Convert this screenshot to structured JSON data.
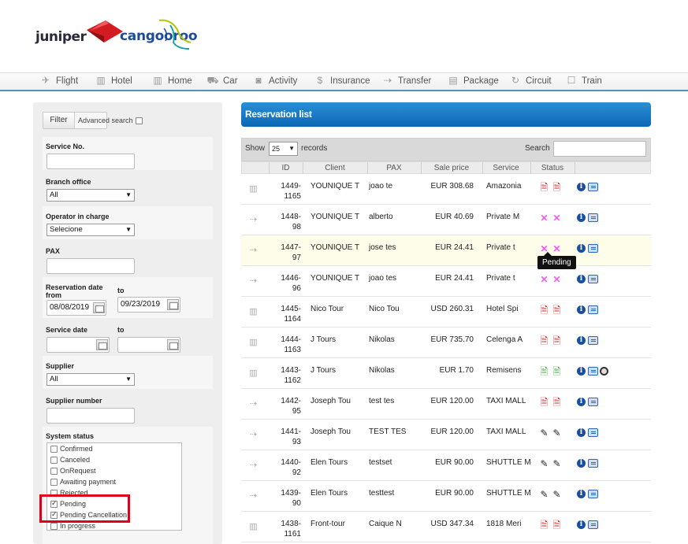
{
  "brand": {
    "left_logo": "juniper",
    "right_logo": "cangooroo",
    "accent": "#0b67b5",
    "highlight_red": "#e0001b"
  },
  "nav": [
    {
      "label": "Flight",
      "icon": "airplane-icon"
    },
    {
      "label": "Hotel",
      "icon": "building-icon"
    },
    {
      "label": "Home",
      "icon": "building-icon"
    },
    {
      "label": "Car",
      "icon": "car-icon"
    },
    {
      "label": "Activity",
      "icon": "camera-icon"
    },
    {
      "label": "Insurance",
      "icon": "dollar-icon"
    },
    {
      "label": "Transfer",
      "icon": "van-icon"
    },
    {
      "label": "Package",
      "icon": "briefcase-icon"
    },
    {
      "label": "Circuit",
      "icon": "cycle-icon"
    },
    {
      "label": "Train",
      "icon": "train-icon"
    }
  ],
  "filter": {
    "button_label": "Filter",
    "advanced_search_label": "Advanced search",
    "advanced_search_checked": false,
    "service_no_label": "Service No.",
    "service_no_value": "",
    "branch_office_label": "Branch office",
    "branch_office_value": "All",
    "operator_label": "Operator in charge",
    "operator_value": "Selecione",
    "pax_label": "PAX",
    "pax_value": "",
    "res_date_label": "Reservation date from",
    "res_date_to_label": "to",
    "res_date_from": "08/08/2019",
    "res_date_to": "09/23/2019",
    "service_date_label": "Service date",
    "service_date_to_label": "to",
    "service_date_from": "",
    "service_date_to": "",
    "supplier_label": "Supplier",
    "supplier_value": "All",
    "supplier_number_label": "Supplier number",
    "supplier_number_value": "",
    "system_status_label": "System status",
    "statuses": [
      {
        "label": "Confirmed",
        "checked": false
      },
      {
        "label": "Canceled",
        "checked": false
      },
      {
        "label": "OnRequest",
        "checked": false
      },
      {
        "label": "Awaiting payment",
        "checked": false
      },
      {
        "label": "Rejected",
        "checked": false
      },
      {
        "label": "Pending",
        "checked": true
      },
      {
        "label": "Pending Cancellation",
        "checked": true
      },
      {
        "label": "In progress",
        "checked": false
      }
    ]
  },
  "list": {
    "title": "Reservation list",
    "show_label": "Show",
    "page_size": "25",
    "records_label": "records",
    "search_label": "Search",
    "search_value": "",
    "columns": [
      "ID",
      "Client",
      "PAX",
      "Sale price",
      "Service",
      "Status"
    ],
    "tooltip": "Pending",
    "rows": [
      {
        "service_icon": "building-icon",
        "id_line1": "1449-",
        "id_line2": "1165",
        "client": "YOUNIQUE T",
        "pax": "joao te",
        "price": "EUR 308.68",
        "service": "Amazonia",
        "status_icon": "pdf-red-icon",
        "status_color": "red",
        "highlight": false,
        "extra_icon": false
      },
      {
        "service_icon": "van-icon",
        "id_line1": "1448-",
        "id_line2": "98",
        "client": "YOUNIQUE T",
        "pax": "alberto",
        "price": "EUR 40.69",
        "service": "Private M",
        "status_icon": "pending-x-icon",
        "status_color": "pink",
        "highlight": false,
        "extra_icon": false
      },
      {
        "service_icon": "van-icon",
        "id_line1": "1447-",
        "id_line2": "97",
        "client": "YOUNIQUE T",
        "pax": "jose tes",
        "price": "EUR 24.41",
        "service": "Private t",
        "status_icon": "pending-x-icon",
        "status_color": "pink",
        "highlight": true,
        "extra_icon": false
      },
      {
        "service_icon": "van-icon",
        "id_line1": "1446-",
        "id_line2": "96",
        "client": "YOUNIQUE T",
        "pax": "joao tes",
        "price": "EUR 24.41",
        "service": "Private t",
        "status_icon": "pending-x-icon",
        "status_color": "pink",
        "highlight": false,
        "extra_icon": false
      },
      {
        "service_icon": "building-icon",
        "id_line1": "1445-",
        "id_line2": "1164",
        "client": "Nico Tour",
        "pax": "Nico Tou",
        "price": "USD 260.31",
        "service": "Hotel Spi",
        "status_icon": "pdf-red-icon",
        "status_color": "red",
        "highlight": false,
        "extra_icon": false
      },
      {
        "service_icon": "building-icon",
        "id_line1": "1444-",
        "id_line2": "1163",
        "client": "J Tours",
        "pax": "Nikolas",
        "price": "EUR 735.70",
        "service": "Celenga A",
        "status_icon": "pdf-red-icon",
        "status_color": "red",
        "highlight": false,
        "extra_icon": false
      },
      {
        "service_icon": "building-icon",
        "id_line1": "1443-",
        "id_line2": "1162",
        "client": "J Tours",
        "pax": "Nikolas",
        "price": "EUR 1.70",
        "service": "Remisens",
        "status_icon": "doc-green-icon",
        "status_color": "green",
        "highlight": false,
        "extra_icon": true
      },
      {
        "service_icon": "van-icon",
        "id_line1": "1442-",
        "id_line2": "95",
        "client": "Joseph Tou",
        "pax": "test tes",
        "price": "EUR 120.00",
        "service": "TAXI MALL",
        "status_icon": "pdf-red-icon",
        "status_color": "red",
        "highlight": false,
        "extra_icon": false
      },
      {
        "service_icon": "van-icon",
        "id_line1": "1441-",
        "id_line2": "93",
        "client": "Joseph Tou",
        "pax": "TEST TES",
        "price": "EUR 120.00",
        "service": "TAXI MALL",
        "status_icon": "edit-doc-icon",
        "status_color": "dark",
        "highlight": false,
        "extra_icon": false
      },
      {
        "service_icon": "van-icon",
        "id_line1": "1440-",
        "id_line2": "92",
        "client": "Elen Tours",
        "pax": "testset",
        "price": "EUR 90.00",
        "service": "SHUTTLE M",
        "status_icon": "edit-doc-icon",
        "status_color": "dark",
        "highlight": false,
        "extra_icon": false
      },
      {
        "service_icon": "van-icon",
        "id_line1": "1439-",
        "id_line2": "90",
        "client": "Elen Tours",
        "pax": "testtest",
        "price": "EUR 90.00",
        "service": "SHUTTLE M",
        "status_icon": "edit-doc-icon",
        "status_color": "dark",
        "highlight": false,
        "extra_icon": false
      },
      {
        "service_icon": "building-icon",
        "id_line1": "1438-",
        "id_line2": "1161",
        "client": "Front-tour",
        "pax": "Caique N",
        "price": "USD 347.34",
        "service": "1818 Meri",
        "status_icon": "pdf-red-icon",
        "status_color": "red",
        "highlight": false,
        "extra_icon": false
      }
    ]
  }
}
